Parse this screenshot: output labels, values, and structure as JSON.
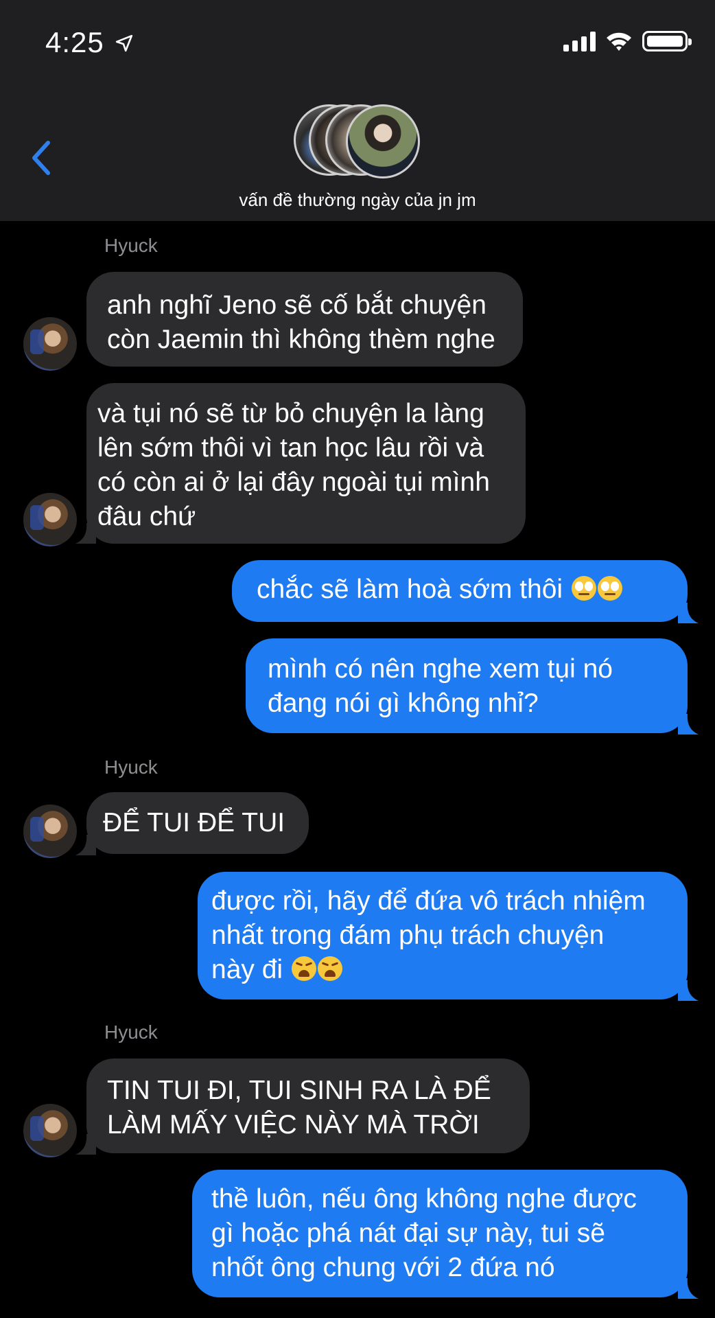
{
  "status_bar": {
    "time": "4:25"
  },
  "header": {
    "group_name": "vấn đề thường ngày của jn jm"
  },
  "messages": [
    {
      "type": "sender",
      "name": "Hyuck"
    },
    {
      "type": "in",
      "lines": [
        "anh nghĩ Jeno sẽ cố bắt chuyện",
        "còn Jaemin thì không thèm nghe"
      ]
    },
    {
      "type": "in",
      "lines": [
        "và tụi nó sẽ từ bỏ chuyện la làng",
        "lên sớm thôi vì tan học lâu rồi và",
        "có còn ai ở lại đây ngoài tụi mình",
        "đâu chứ"
      ]
    },
    {
      "type": "out",
      "lines": [
        "chắc sẽ làm hoà sớm thôi"
      ],
      "emoji": "face-with-rolling-eyes x2"
    },
    {
      "type": "out",
      "lines": [
        "mình có nên nghe xem tụi nó",
        "đang nói gì không nhỉ?"
      ]
    },
    {
      "type": "sender",
      "name": "Hyuck"
    },
    {
      "type": "in",
      "lines": [
        "ĐỂ TUI ĐỂ TUI"
      ]
    },
    {
      "type": "out",
      "lines": [
        "được rồi, hãy để đứa vô trách nhiệm",
        "nhất trong đám phụ trách chuyện",
        "này đi"
      ],
      "emoji": "weary-face x2"
    },
    {
      "type": "sender",
      "name": "Hyuck"
    },
    {
      "type": "in",
      "lines": [
        "TIN TUI ĐI, TUI SINH RA LÀ ĐỂ",
        "LÀM MẤY VIỆC NÀY MÀ TRỜI"
      ]
    },
    {
      "type": "out",
      "lines": [
        "thề luôn, nếu ông không nghe được",
        "gì hoặc phá nát đại sự này, tui sẽ",
        "nhốt ông chung với 2 đứa nó"
      ]
    }
  ],
  "colors": {
    "incoming": "#2c2c2e",
    "outgoing": "#1f7bf2",
    "header": "#1f1f21",
    "back": "#2f80ed"
  }
}
